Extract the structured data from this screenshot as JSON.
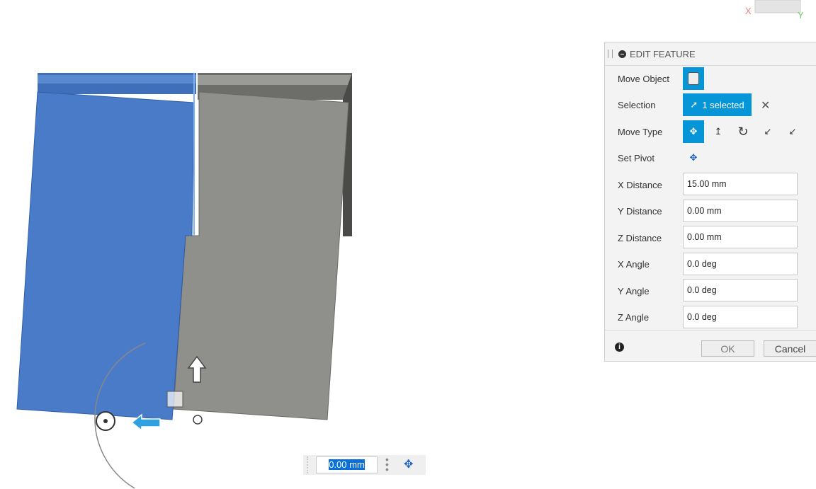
{
  "panel": {
    "title": "EDIT FEATURE",
    "rows": {
      "move_object": "Move Object",
      "selection": "Selection",
      "selection_value": "1 selected",
      "move_type": "Move Type",
      "set_pivot": "Set Pivot"
    },
    "fields": [
      {
        "label": "X Distance",
        "value": "15.00 mm"
      },
      {
        "label": "Y Distance",
        "value": "0.00 mm"
      },
      {
        "label": "Z Distance",
        "value": "0.00 mm"
      },
      {
        "label": "X Angle",
        "value": "0.0 deg"
      },
      {
        "label": "Y Angle",
        "value": "0.0 deg"
      },
      {
        "label": "Z Angle",
        "value": "0.0 deg"
      }
    ],
    "ok": "OK",
    "cancel": "Cancel"
  },
  "mini_toolbar": {
    "value": "0.00 mm"
  },
  "viewcube": {
    "x_label": "X",
    "y_label": "Y"
  },
  "colors": {
    "accent": "#0696d7",
    "selected_body": "#4a7bc8",
    "other_body": "#8e8f8a"
  }
}
